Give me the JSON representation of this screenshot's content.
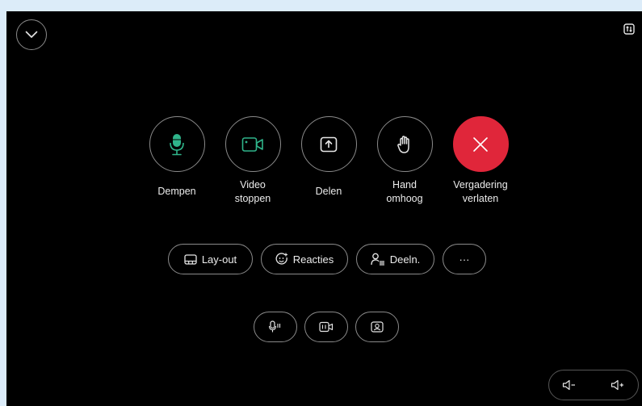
{
  "colors": {
    "background": "#000000",
    "frame": "#dcecf9",
    "outline": "#8a8a8a",
    "text": "#ececec",
    "accent_green": "#2fb48a",
    "leave_red": "#e0263a"
  },
  "top_bar": {
    "collapse_icon": "chevron-down-icon",
    "right_icon": "swap-icon"
  },
  "main_controls": [
    {
      "id": "mute",
      "label": "Dempen",
      "icon": "microphone-icon"
    },
    {
      "id": "video",
      "label": "Video\nstoppen",
      "icon": "video-camera-icon"
    },
    {
      "id": "share",
      "label": "Delen",
      "icon": "share-screen-icon"
    },
    {
      "id": "hand",
      "label": "Hand\nomhoog",
      "icon": "raise-hand-icon"
    },
    {
      "id": "leave",
      "label": "Vergadering\nverlaten",
      "icon": "close-icon"
    }
  ],
  "pills": {
    "layout": "Lay-out",
    "reactions": "Reacties",
    "participants": "Deeln.",
    "more": "···"
  },
  "small_controls": [
    {
      "id": "mic-settings",
      "icon": "microphone-settings-icon"
    },
    {
      "id": "camera-settings",
      "icon": "camera-settings-icon"
    },
    {
      "id": "self-view",
      "icon": "self-view-icon"
    }
  ],
  "volume": {
    "down_icon": "volume-down-icon",
    "up_icon": "volume-up-icon"
  }
}
